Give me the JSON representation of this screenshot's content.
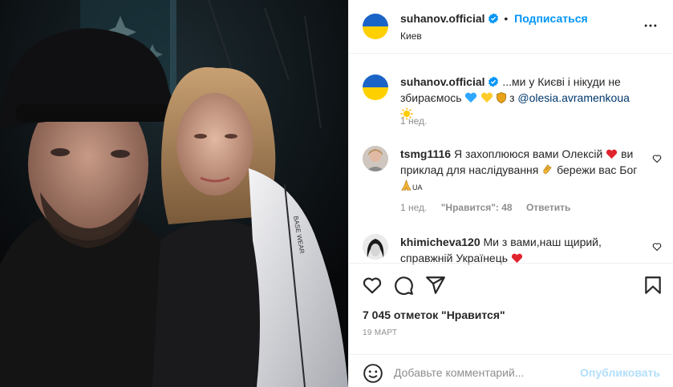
{
  "post": {
    "username": "suhanov.official",
    "follow_label": "Подписаться",
    "location": "Киев",
    "brand_color": "#0095f6"
  },
  "caption": {
    "username": "suhanov.official",
    "text": "...ми у Києві і нікуди не збираємось",
    "with_text": "з",
    "mention": "@olesia.avramenkoua",
    "emojis": [
      "blue-heart",
      "yellow-heart",
      "shield",
      "sun"
    ],
    "time": "1 нед."
  },
  "comments": [
    {
      "username": "tsmg1116",
      "text": "Я захоплююся вами Олексій",
      "text2": "ви приклад для наслідування",
      "text3": "бережи вас Бог",
      "suffix": "UA",
      "time": "1 нед.",
      "likes": "\"Нравится\": 48",
      "reply": "Ответить"
    },
    {
      "username": "khimicheva120",
      "text": "Ми з вами,наш щирий, справжній Українець"
    }
  ],
  "likes_text": "7 045 отметок \"Нравится\"",
  "date": "19 МАРТ",
  "add_comment": {
    "placeholder": "Добавьте комментарий...",
    "post_label": "Опубликовать"
  },
  "flag_colors": {
    "top": "#1a64c8",
    "bottom": "#ffd000"
  }
}
